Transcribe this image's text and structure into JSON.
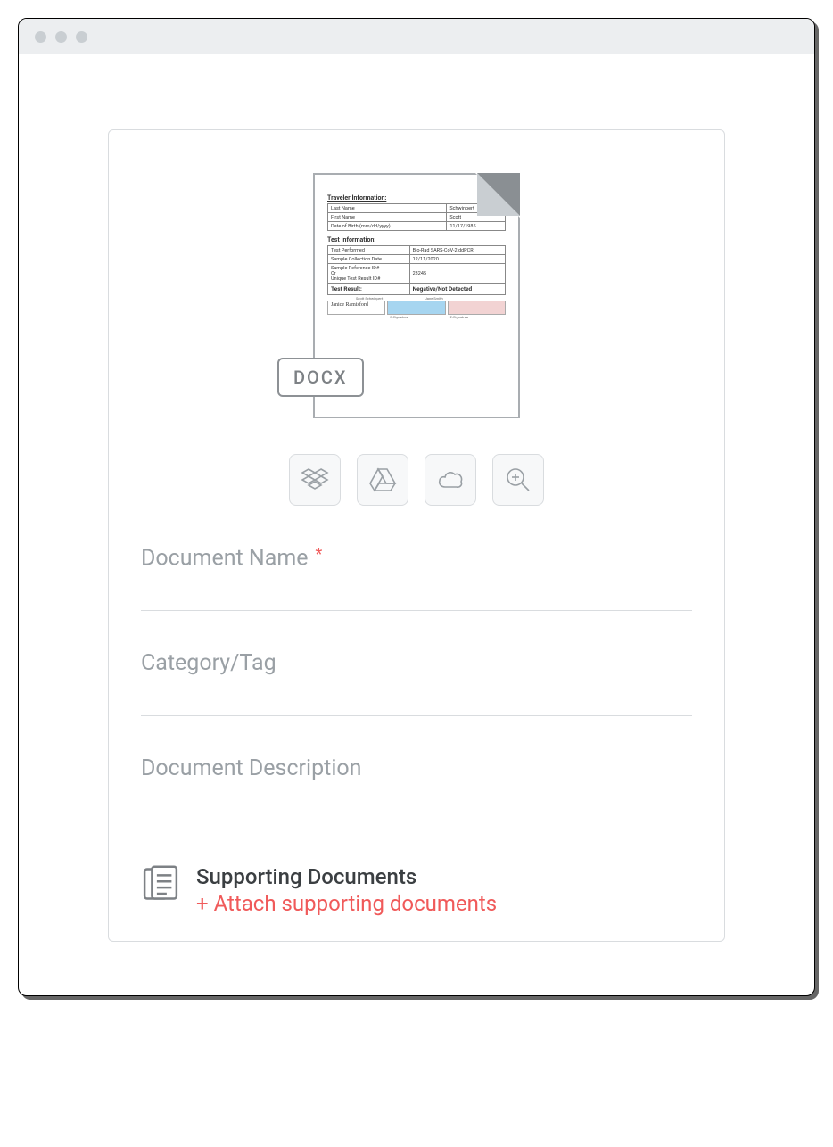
{
  "preview": {
    "badge": "DOCX",
    "section1_title": "Traveler Information:",
    "section2_title": "Test Information:",
    "traveler": {
      "row1_label": "Last Name",
      "row1_value": "Schwinpert",
      "row2_label": "First Name",
      "row2_value": "Scott",
      "row3_label": "Date of Birth (mm/dd/yyyy)",
      "row3_value": "11/17/1985"
    },
    "test": {
      "row1_label": "Test Performed",
      "row1_value": "Bio-Rad SARS-CoV-2 ddPCR",
      "row2_label": "Sample Collection Date",
      "row2_value": "12/11/2020",
      "row3_label": "Sample Reference ID#\nOr\nUnique Test Result ID#",
      "row3_value": "23245",
      "result_label": "Test Result:",
      "result_value": "Negative/Not Detected"
    },
    "sig": {
      "name_script": "Janice Ramisford",
      "top1": "Scott Schwinpert",
      "top2": "Jane Smith",
      "lab1": "E-Signature",
      "lab2": "E-Signature"
    }
  },
  "toolbar": {
    "dropbox": "dropbox",
    "gdrive": "google-drive",
    "cloud": "cloud",
    "zoom": "zoom-in"
  },
  "fields": {
    "doc_name_label": "Document Name",
    "required_mark": "*",
    "category_label": "Category/Tag",
    "description_label": "Document Description"
  },
  "supporting": {
    "title": "Supporting Documents",
    "link": "+ Attach supporting documents"
  }
}
